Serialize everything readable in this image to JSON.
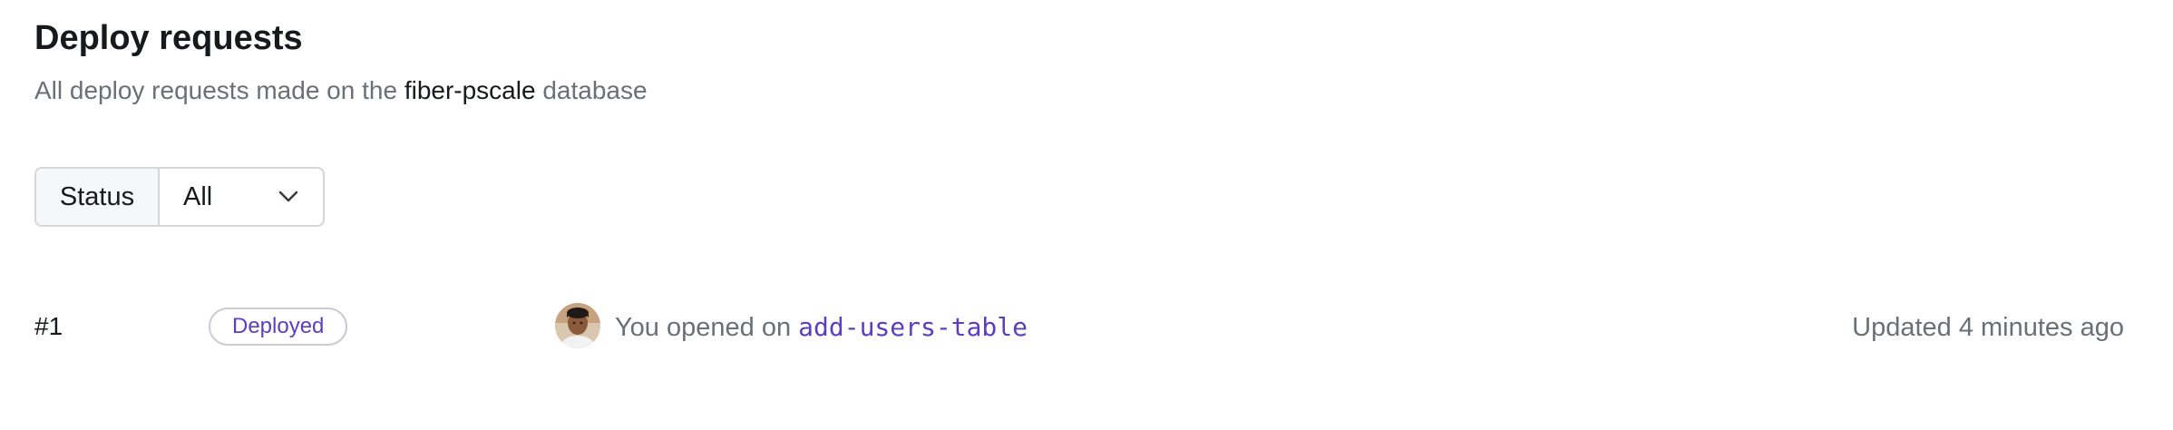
{
  "header": {
    "title": "Deploy requests",
    "subtitle_prefix": "All deploy requests made on the ",
    "database_name": "fiber-pscale",
    "subtitle_suffix": " database"
  },
  "filter": {
    "label": "Status",
    "selected": "All"
  },
  "requests": [
    {
      "number": "#1",
      "status": "Deployed",
      "status_color": "#5b3fbf",
      "activity_prefix": "You opened on ",
      "branch": "add-users-table",
      "updated": "Updated 4 minutes ago"
    }
  ],
  "icons": {
    "filter_chevron": "chevron-down-icon",
    "avatar": "avatar"
  }
}
